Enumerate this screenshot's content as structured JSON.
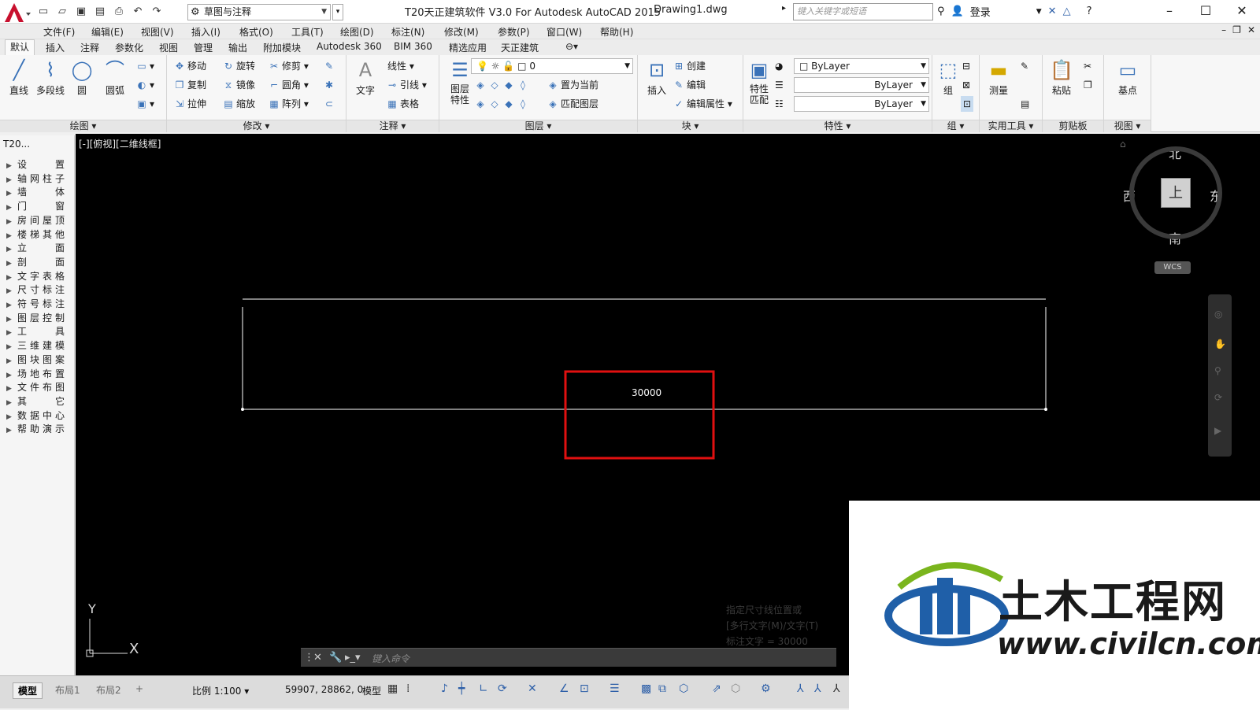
{
  "titlebar": {
    "app_title": "T20天正建筑软件 V3.0 For Autodesk AutoCAD 2015",
    "doc_title": "Drawing1.dwg",
    "workspace": "草图与注释",
    "search_placeholder": "键入关键字或短语",
    "login": "登录"
  },
  "menubar": {
    "items": [
      "文件(F)",
      "编辑(E)",
      "视图(V)",
      "插入(I)",
      "格式(O)",
      "工具(T)",
      "绘图(D)",
      "标注(N)",
      "修改(M)",
      "参数(P)",
      "窗口(W)",
      "帮助(H)"
    ]
  },
  "ribbon_tabs": {
    "items": [
      "默认",
      "插入",
      "注释",
      "参数化",
      "视图",
      "管理",
      "输出",
      "附加模块",
      "Autodesk 360",
      "BIM 360",
      "精选应用",
      "天正建筑"
    ],
    "active": "默认"
  },
  "ribbon": {
    "draw": {
      "title": "绘图",
      "line": "直线",
      "polyline": "多段线",
      "circle": "圆",
      "arc": "圆弧"
    },
    "modify": {
      "title": "修改",
      "move": "移动",
      "rotate": "旋转",
      "trim": "修剪",
      "copy": "复制",
      "mirror": "镜像",
      "fillet": "圆角",
      "stretch": "拉伸",
      "scale": "缩放",
      "array": "阵列"
    },
    "annotation": {
      "title": "注释",
      "text": "文字",
      "linear": "线性",
      "leader": "引线",
      "table": "表格"
    },
    "layers": {
      "title": "图层",
      "layer_props": "图层特性",
      "layer_value": "0",
      "set_current": "置为当前",
      "match_layer": "匹配图层"
    },
    "block": {
      "title": "块",
      "insert": "插入",
      "create": "创建",
      "edit": "编辑",
      "edit_attr": "编辑属性"
    },
    "properties": {
      "title": "特性",
      "match": "特性匹配",
      "color": "ByLayer",
      "linetype": "ByLayer",
      "lineweight": "ByLayer"
    },
    "groups": {
      "title": "组",
      "group": "组"
    },
    "utilities": {
      "title": "实用工具",
      "measure": "测量"
    },
    "clipboard": {
      "title": "剪贴板",
      "paste": "粘贴"
    },
    "view": {
      "title": "视图",
      "base": "基点"
    }
  },
  "palette": {
    "title": "T20...",
    "items": [
      "设置",
      "轴网柱子",
      "墙体",
      "门窗",
      "房间屋顶",
      "楼梯其他",
      "立面",
      "剖面",
      "文字表格",
      "尺寸标注",
      "符号标注",
      "图层控制",
      "工具",
      "三维建模",
      "图块图案",
      "场地布置",
      "文件布图",
      "其它",
      "数据中心",
      "帮助演示"
    ]
  },
  "canvas": {
    "view_label": "[-][俯视][二维线框]",
    "dimension_value": "30000",
    "viewcube": {
      "north": "北",
      "south": "南",
      "east": "东",
      "west": "西",
      "face": "上",
      "wcs": "WCS"
    },
    "ucs": {
      "y": "Y",
      "x": "X"
    },
    "command_placeholder": "键入命令",
    "history": [
      "指定尺寸线位置或",
      "[多行文字(M)/文字(T)",
      "标注文字 = 30000"
    ]
  },
  "statusbar": {
    "tabs": [
      "模型",
      "布局1",
      "布局2"
    ],
    "scale": "比例 1:100",
    "coords": "59907, 28862, 0",
    "space": "模型"
  },
  "watermark": {
    "brand": "土木工程网",
    "url": "www.civilcn.com"
  },
  "colors": {
    "highlight_box": "#e01010",
    "canvas_bg": "#000000",
    "logo_blue": "#1f5fa8",
    "logo_green": "#7ab51d"
  }
}
